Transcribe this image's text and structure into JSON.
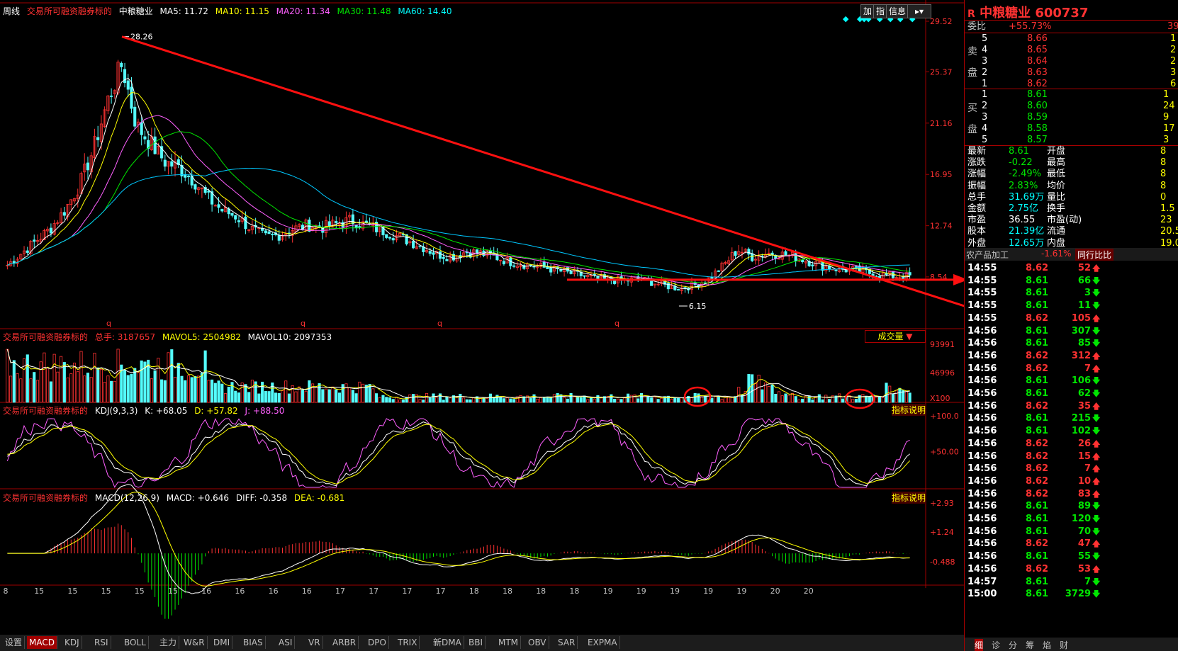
{
  "header": {
    "period": "周线",
    "source": "交易所可融资融券标的",
    "stock": "中粮糖业",
    "ma5": "MA5: 11.72",
    "ma10": "MA10: 11.15",
    "ma20": "MA20: 11.34",
    "ma30": "MA30: 11.48",
    "ma60": "MA60: 14.40",
    "btn_add": "加",
    "btn_idx": "指",
    "btn_info": "信息"
  },
  "price_axis": {
    "labels": [
      "29.52",
      "25.37",
      "21.16",
      "16.95",
      "12.74",
      "8.54"
    ],
    "high_label": "28.26",
    "low_label": "6.15"
  },
  "volume_panel": {
    "source": "交易所可融资融券标的",
    "total": "总手: 3187657",
    "mavol5": "MAVOL5: 2504982",
    "mavol10": "MAVOL10: 2097353",
    "dropdown": "成交量",
    "axis": [
      "93991",
      "46996",
      "X100"
    ]
  },
  "kdj_panel": {
    "source": "交易所可融资融券标的",
    "name": "KDJ(9,3,3)",
    "k": "K: +68.05",
    "d": "D: +57.82",
    "j": "J: +88.50",
    "help": "指标说明",
    "axis": [
      "+100.0",
      "+50.00"
    ]
  },
  "macd_panel": {
    "source": "交易所可融资融券标的",
    "name": "MACD(12,26,9)",
    "macd": "MACD: +0.646",
    "diff": "DIFF: -0.358",
    "dea": "DEA: -0.681",
    "help": "指标说明",
    "axis": [
      "+2.93",
      "+1.24",
      "-0.488"
    ]
  },
  "x_labels": [
    "8",
    "15",
    "15",
    "15",
    "15",
    "15",
    "16",
    "16",
    "16",
    "16",
    "17",
    "17",
    "17",
    "17",
    "18",
    "18",
    "18",
    "18",
    "19",
    "19",
    "19",
    "19",
    "19",
    "20",
    "20"
  ],
  "tabs": [
    "设置",
    "MACD",
    "KDJ",
    "RSI",
    "BOLL",
    "主力",
    "W&R",
    "DMI",
    "BIAS",
    "ASI",
    "VR",
    "ARBR",
    "DPO",
    "TRIX",
    "新DMA",
    "BBI",
    "MTM",
    "OBV",
    "SAR",
    "EXPMA"
  ],
  "right_panel": {
    "title": "中粮糖业 600737",
    "r_mark": "R",
    "weibi_label": "委比",
    "weibi_value": "+55.73%",
    "weibi_extra": "39",
    "sell_label_top": "卖",
    "sell_label_bot": "盘",
    "buy_label_top": "买",
    "buy_label_bot": "盘",
    "asks": [
      {
        "lvl": "5",
        "price": "8.66",
        "vol": "1"
      },
      {
        "lvl": "4",
        "price": "8.65",
        "vol": "2"
      },
      {
        "lvl": "3",
        "price": "8.64",
        "vol": "2"
      },
      {
        "lvl": "2",
        "price": "8.63",
        "vol": "3"
      },
      {
        "lvl": "1",
        "price": "8.62",
        "vol": "6"
      }
    ],
    "bids": [
      {
        "lvl": "1",
        "price": "8.61",
        "vol": "1"
      },
      {
        "lvl": "2",
        "price": "8.60",
        "vol": "24"
      },
      {
        "lvl": "3",
        "price": "8.59",
        "vol": "9"
      },
      {
        "lvl": "4",
        "price": "8.58",
        "vol": "17"
      },
      {
        "lvl": "5",
        "price": "8.57",
        "vol": "3"
      }
    ],
    "stats": [
      {
        "l": "最新",
        "v": "8.61",
        "l2": "开盘",
        "v2": "8"
      },
      {
        "l": "涨跌",
        "v": "-0.22",
        "l2": "最高",
        "v2": "8"
      },
      {
        "l": "涨幅",
        "v": "-2.49%",
        "l2": "最低",
        "v2": "8"
      },
      {
        "l": "振幅",
        "v": "2.83%",
        "l2": "均价",
        "v2": "8"
      },
      {
        "l": "总手",
        "v": "31.69万",
        "l2": "量比",
        "v2": "0"
      },
      {
        "l": "金额",
        "v": "2.75亿",
        "l2": "换手",
        "v2": "1.5"
      },
      {
        "l": "市盈",
        "v": "36.55",
        "l2": "市盈(动)",
        "v2": "23"
      },
      {
        "l": "股本",
        "v": "21.39亿",
        "l2": "流通",
        "v2": "20.52"
      },
      {
        "l": "外盘",
        "v": "12.65万",
        "l2": "内盘",
        "v2": "19.04"
      }
    ],
    "industry": "农产品加工",
    "industry_pct": "-1.61%",
    "compare_btn": "同行比比",
    "ticks": [
      {
        "t": "14:55",
        "p": "8.62",
        "v": "52",
        "d": "up"
      },
      {
        "t": "14:55",
        "p": "8.61",
        "v": "66",
        "d": "down"
      },
      {
        "t": "14:55",
        "p": "8.61",
        "v": "3",
        "d": "down"
      },
      {
        "t": "14:55",
        "p": "8.61",
        "v": "11",
        "d": "down"
      },
      {
        "t": "14:55",
        "p": "8.62",
        "v": "105",
        "d": "up"
      },
      {
        "t": "14:56",
        "p": "8.61",
        "v": "307",
        "d": "down"
      },
      {
        "t": "14:56",
        "p": "8.61",
        "v": "85",
        "d": "down"
      },
      {
        "t": "14:56",
        "p": "8.62",
        "v": "312",
        "d": "up"
      },
      {
        "t": "14:56",
        "p": "8.62",
        "v": "7",
        "d": "up"
      },
      {
        "t": "14:56",
        "p": "8.61",
        "v": "106",
        "d": "down"
      },
      {
        "t": "14:56",
        "p": "8.61",
        "v": "62",
        "d": "down"
      },
      {
        "t": "14:56",
        "p": "8.62",
        "v": "35",
        "d": "up"
      },
      {
        "t": "14:56",
        "p": "8.61",
        "v": "215",
        "d": "down"
      },
      {
        "t": "14:56",
        "p": "8.61",
        "v": "102",
        "d": "down"
      },
      {
        "t": "14:56",
        "p": "8.62",
        "v": "26",
        "d": "up"
      },
      {
        "t": "14:56",
        "p": "8.62",
        "v": "15",
        "d": "up"
      },
      {
        "t": "14:56",
        "p": "8.62",
        "v": "7",
        "d": "up"
      },
      {
        "t": "14:56",
        "p": "8.62",
        "v": "10",
        "d": "up"
      },
      {
        "t": "14:56",
        "p": "8.62",
        "v": "83",
        "d": "up"
      },
      {
        "t": "14:56",
        "p": "8.61",
        "v": "89",
        "d": "down"
      },
      {
        "t": "14:56",
        "p": "8.61",
        "v": "120",
        "d": "down"
      },
      {
        "t": "14:56",
        "p": "8.61",
        "v": "70",
        "d": "down"
      },
      {
        "t": "14:56",
        "p": "8.62",
        "v": "47",
        "d": "up"
      },
      {
        "t": "14:56",
        "p": "8.61",
        "v": "55",
        "d": "down"
      },
      {
        "t": "14:56",
        "p": "8.62",
        "v": "53",
        "d": "up"
      },
      {
        "t": "14:57",
        "p": "8.61",
        "v": "7",
        "d": "down"
      },
      {
        "t": "15:00",
        "p": "8.61",
        "v": "3729",
        "d": "down"
      }
    ],
    "bottom_tabs": [
      "细",
      "诊",
      "分",
      "筹",
      "焰",
      "财"
    ]
  },
  "chart_data": {
    "type": "candlestick",
    "title": "中粮糖业 周线",
    "ylim": [
      6.15,
      29.52
    ],
    "price_path": [
      9.5,
      10.5,
      11.5,
      12.5,
      14,
      16,
      19,
      23,
      26,
      21,
      19.5,
      18,
      17.5,
      16.5,
      15,
      14,
      13.5,
      12.5,
      11.8,
      12,
      12.5,
      12.8,
      12.6,
      12.9,
      13.2,
      12.8,
      12.4,
      12,
      11.5,
      11,
      10.4,
      10.2,
      10.6,
      10.5,
      10.2,
      9.8,
      9.6,
      9.4,
      9.2,
      8.9,
      8.7,
      8.4,
      8.3,
      8.2,
      8.4,
      8.1,
      7.8,
      7.6,
      7.9,
      8.4,
      9.5,
      10.8,
      10.2,
      10.5,
      10.4,
      10.2,
      9.8,
      9.4,
      9.2,
      9.1,
      8.9,
      8.7,
      8.6,
      8.61
    ],
    "annotations": {
      "high": 28.26,
      "low": 6.15
    },
    "trendlines": [
      "downtrend from 28.26 high",
      "horizontal support near 8.54"
    ]
  }
}
